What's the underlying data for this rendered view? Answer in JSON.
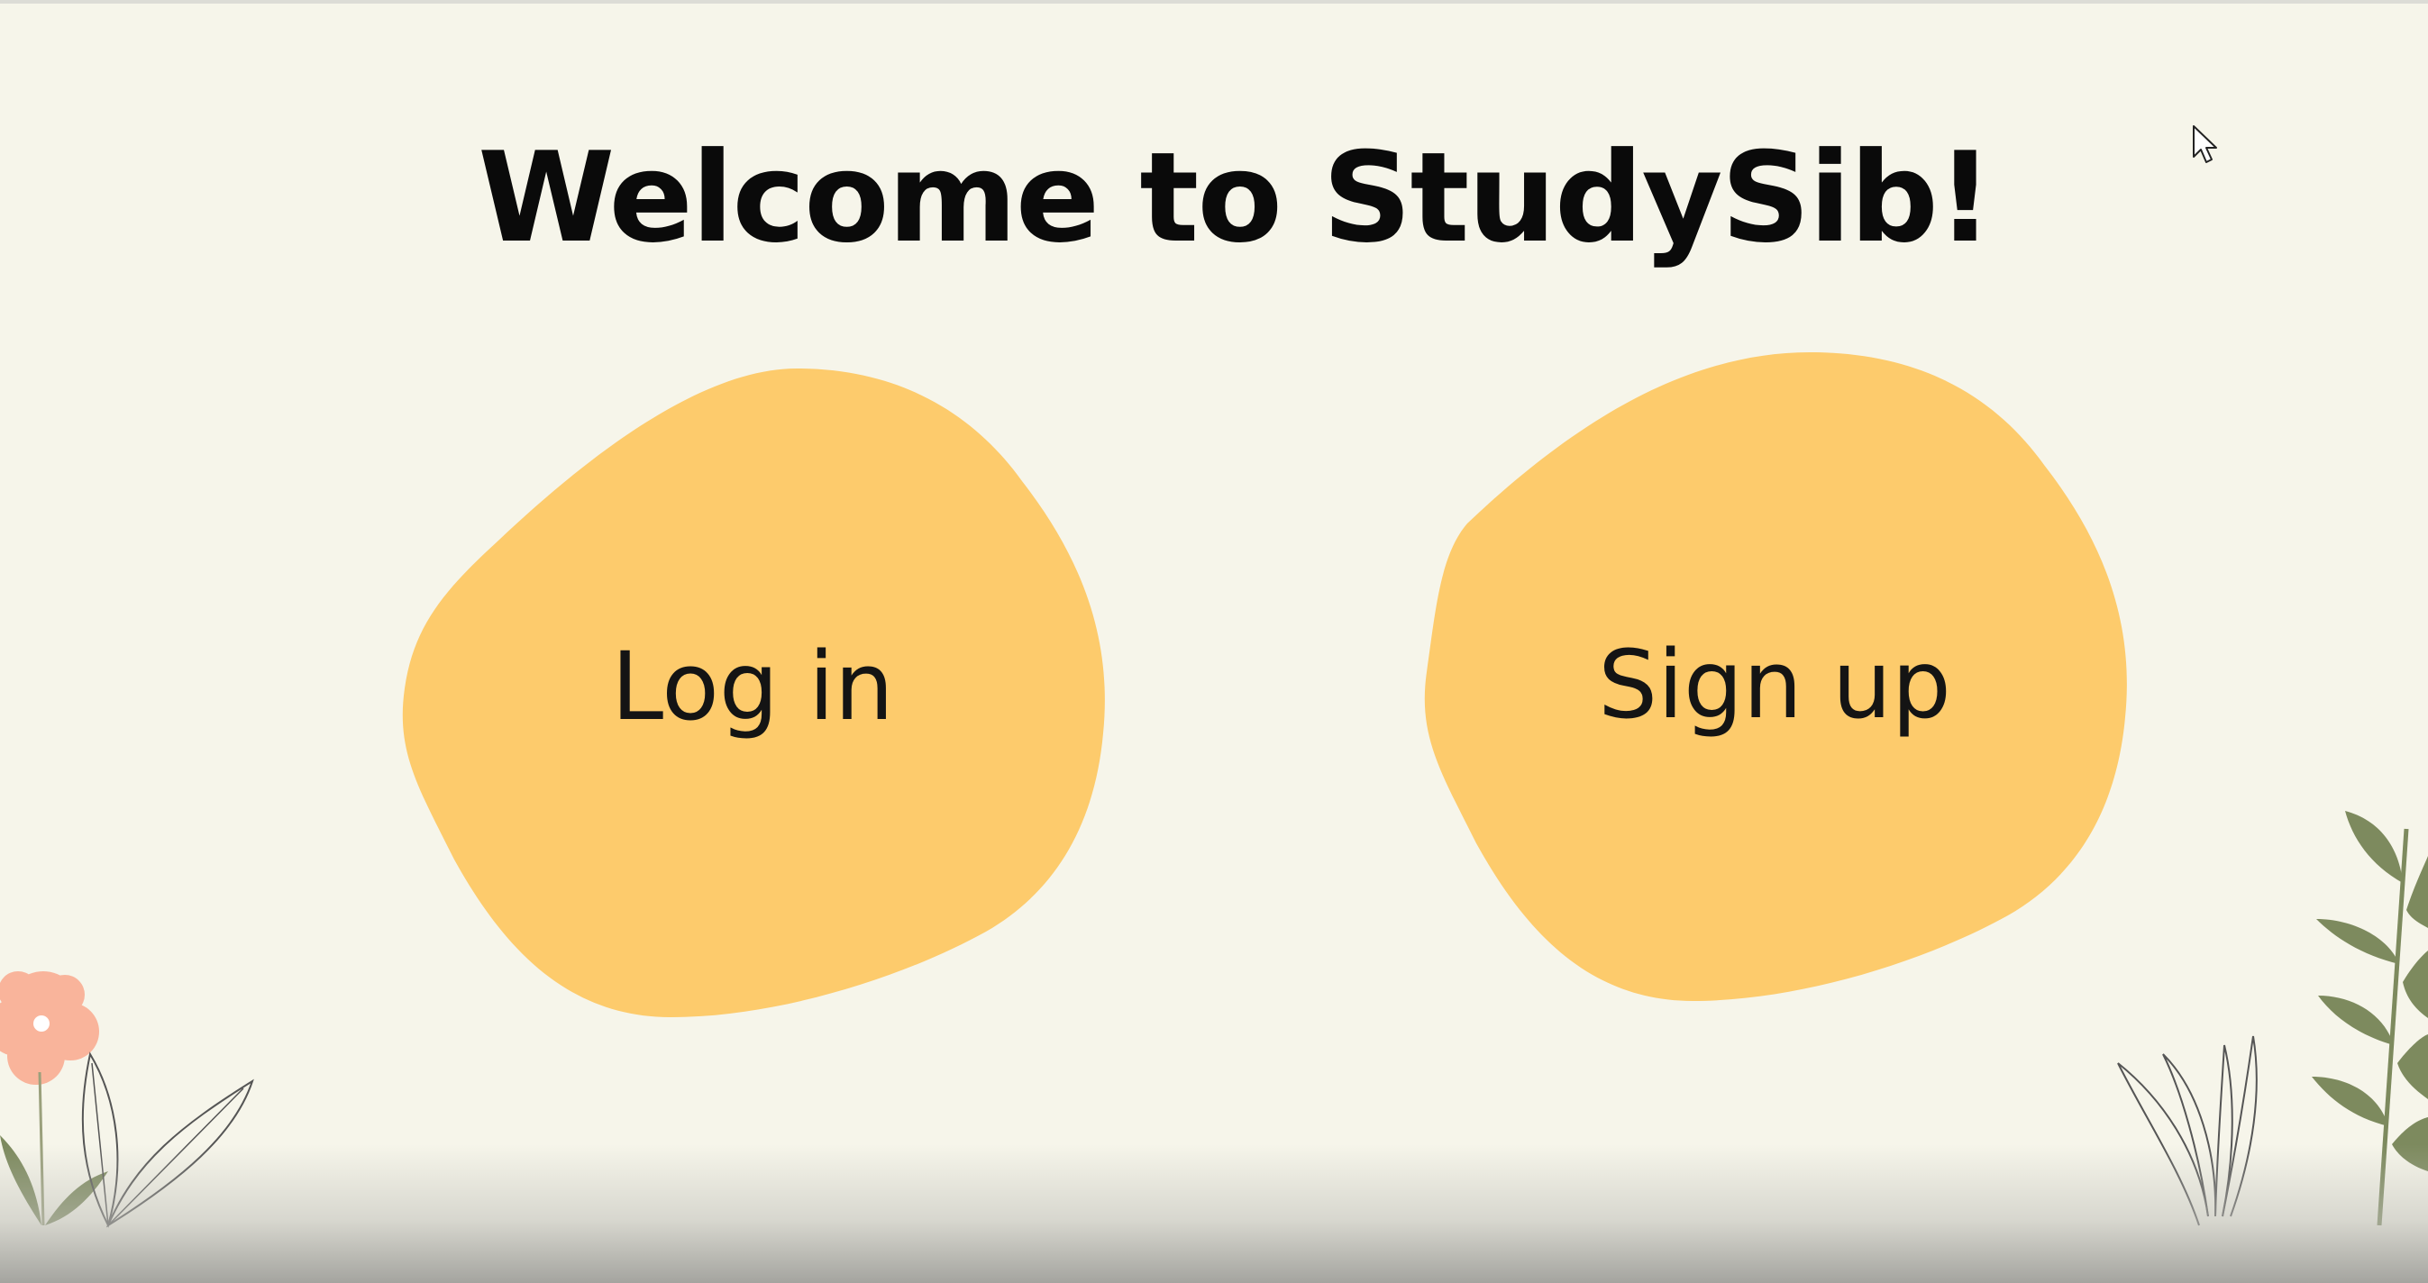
{
  "page": {
    "title": "Welcome to StudySib!"
  },
  "actions": {
    "login_label": "Log in",
    "signup_label": "Sign up"
  },
  "colors": {
    "background": "#f6f5ea",
    "blob": "#fdcb6c",
    "flower": "#f9b49b",
    "leaf": "#7d8a5e",
    "title_text": "#0a0a0a"
  },
  "decorations": {
    "left": "flower-and-leaves-illustration",
    "right": "fern-and-grass-illustration",
    "pointer": "mouse-cursor-icon"
  }
}
